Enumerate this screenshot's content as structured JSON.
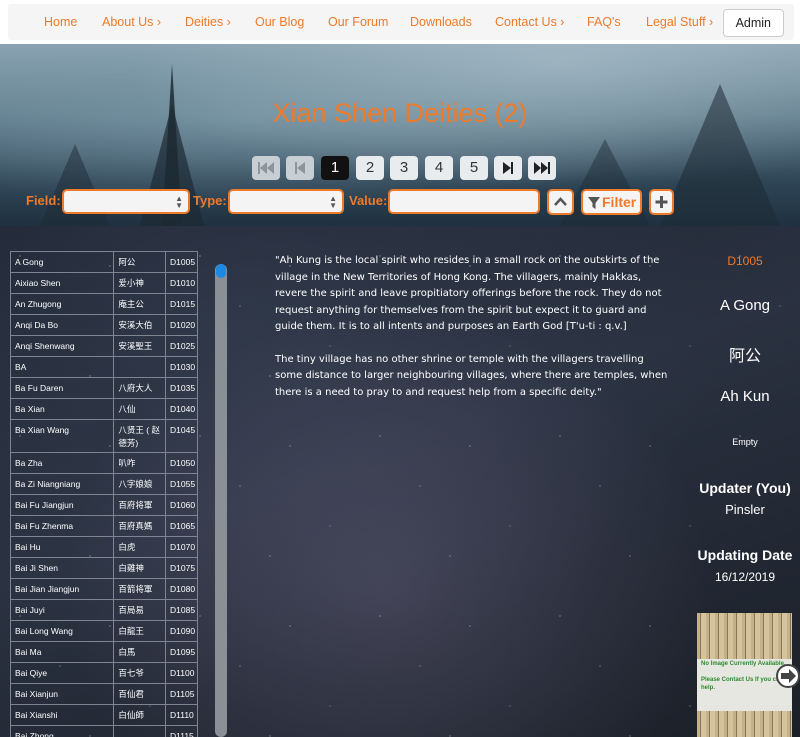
{
  "nav": {
    "items": [
      {
        "label": "Home"
      },
      {
        "label": "About Us ›"
      },
      {
        "label": "Deities ›"
      },
      {
        "label": "Our Blog"
      },
      {
        "label": "Our Forum"
      },
      {
        "label": "Downloads"
      },
      {
        "label": "Contact Us ›"
      },
      {
        "label": "FAQ's"
      },
      {
        "label": "Legal Stuff ›"
      }
    ],
    "admin_label": "Admin"
  },
  "hero": {
    "title": "Xian Shen Deities (2)"
  },
  "pagination": {
    "pages": [
      "1",
      "2",
      "3",
      "4",
      "5"
    ],
    "current": "1"
  },
  "filter": {
    "field_label": "Field:",
    "type_label": "Type:",
    "value_label": "Value:",
    "field_value": "",
    "type_value": "",
    "value_value": "",
    "filter_button_label": "Filter"
  },
  "deities": [
    {
      "name": "A Gong",
      "chinese": "阿公",
      "code": "D1005"
    },
    {
      "name": "Aixiao Shen",
      "chinese": "爱小神",
      "code": "D1010"
    },
    {
      "name": "An Zhugong",
      "chinese": "庵主公",
      "code": "D1015"
    },
    {
      "name": "Anqi Da Bo",
      "chinese": "安溪大伯",
      "code": "D1020"
    },
    {
      "name": "Anqi Shenwang",
      "chinese": "安溪聖王",
      "code": "D1025"
    },
    {
      "name": "BA",
      "chinese": "",
      "code": "D1030"
    },
    {
      "name": "Ba Fu Daren",
      "chinese": "八府大人",
      "code": "D1035"
    },
    {
      "name": "Ba Xian",
      "chinese": "八仙",
      "code": "D1040"
    },
    {
      "name": "Ba Xian Wang",
      "chinese": "八贤王 ( 赵德芳)",
      "code": "D1045"
    },
    {
      "name": "Ba Zha",
      "chinese": "叭咋",
      "code": "D1050"
    },
    {
      "name": "Ba Zi Niangniang",
      "chinese": "八字娘娘",
      "code": "D1055"
    },
    {
      "name": "Bai Fu Jiangjun",
      "chinese": "百府将軍",
      "code": "D1060"
    },
    {
      "name": "Bai Fu Zhenma",
      "chinese": "百府真媽",
      "code": "D1065"
    },
    {
      "name": "Bai Hu",
      "chinese": "白虎",
      "code": "D1070"
    },
    {
      "name": "Bai Ji Shen",
      "chinese": "白雞神",
      "code": "D1075"
    },
    {
      "name": "Bai Jian Jiangjun",
      "chinese": "百箭将軍",
      "code": "D1080"
    },
    {
      "name": "Bai Juyi",
      "chinese": "百局易",
      "code": "D1085"
    },
    {
      "name": "Bai Long Wang",
      "chinese": "白龍王",
      "code": "D1090"
    },
    {
      "name": "Bai Ma",
      "chinese": "白馬",
      "code": "D1095"
    },
    {
      "name": "Bai Qiye",
      "chinese": "百七爷",
      "code": "D1100"
    },
    {
      "name": "Bai Xianjun",
      "chinese": "百仙君",
      "code": "D1105"
    },
    {
      "name": "Bai Xianshi",
      "chinese": "白仙師",
      "code": "D1110"
    },
    {
      "name": "Bai Zhong",
      "chinese": "",
      "code": "D1115"
    },
    {
      "name": "",
      "chinese": "",
      "code": ""
    }
  ],
  "description": {
    "p1": "\"Ah Kung is the local spirit who resides in a small rock on the outskirts of the village in the New Territories of Hong Kong. The villagers, mainly Hakkas, revere the spirit and leave propitiatory offerings before the rock. They do not request anything for themselves from the spirit but expect it to guard and guide them. It is to all intents and purposes an Earth God [T'u-ti : q.v.]",
    "p2": "The tiny village has no other shrine or temple with the villagers travelling some distance to larger neighbouring villages, where there are temples, when there is a need to pray to and request help from a specific deity.\""
  },
  "detail": {
    "id": "D1005",
    "english_name": "A Gong",
    "chinese_name": "阿公",
    "pinyin": "Ah Kun",
    "empty_note": "Empty",
    "updater_label": "Updater (You)",
    "updater_value": "Pinsler",
    "updating_date_label": "Updating Date",
    "updating_date_value": "16/12/2019",
    "image_notice_1": "No Image Currently Available.",
    "image_notice_2": "Please Contact Us If you can help."
  },
  "colors": {
    "accent": "#ef7a2a",
    "scroll_thumb": "#1e88e5"
  }
}
